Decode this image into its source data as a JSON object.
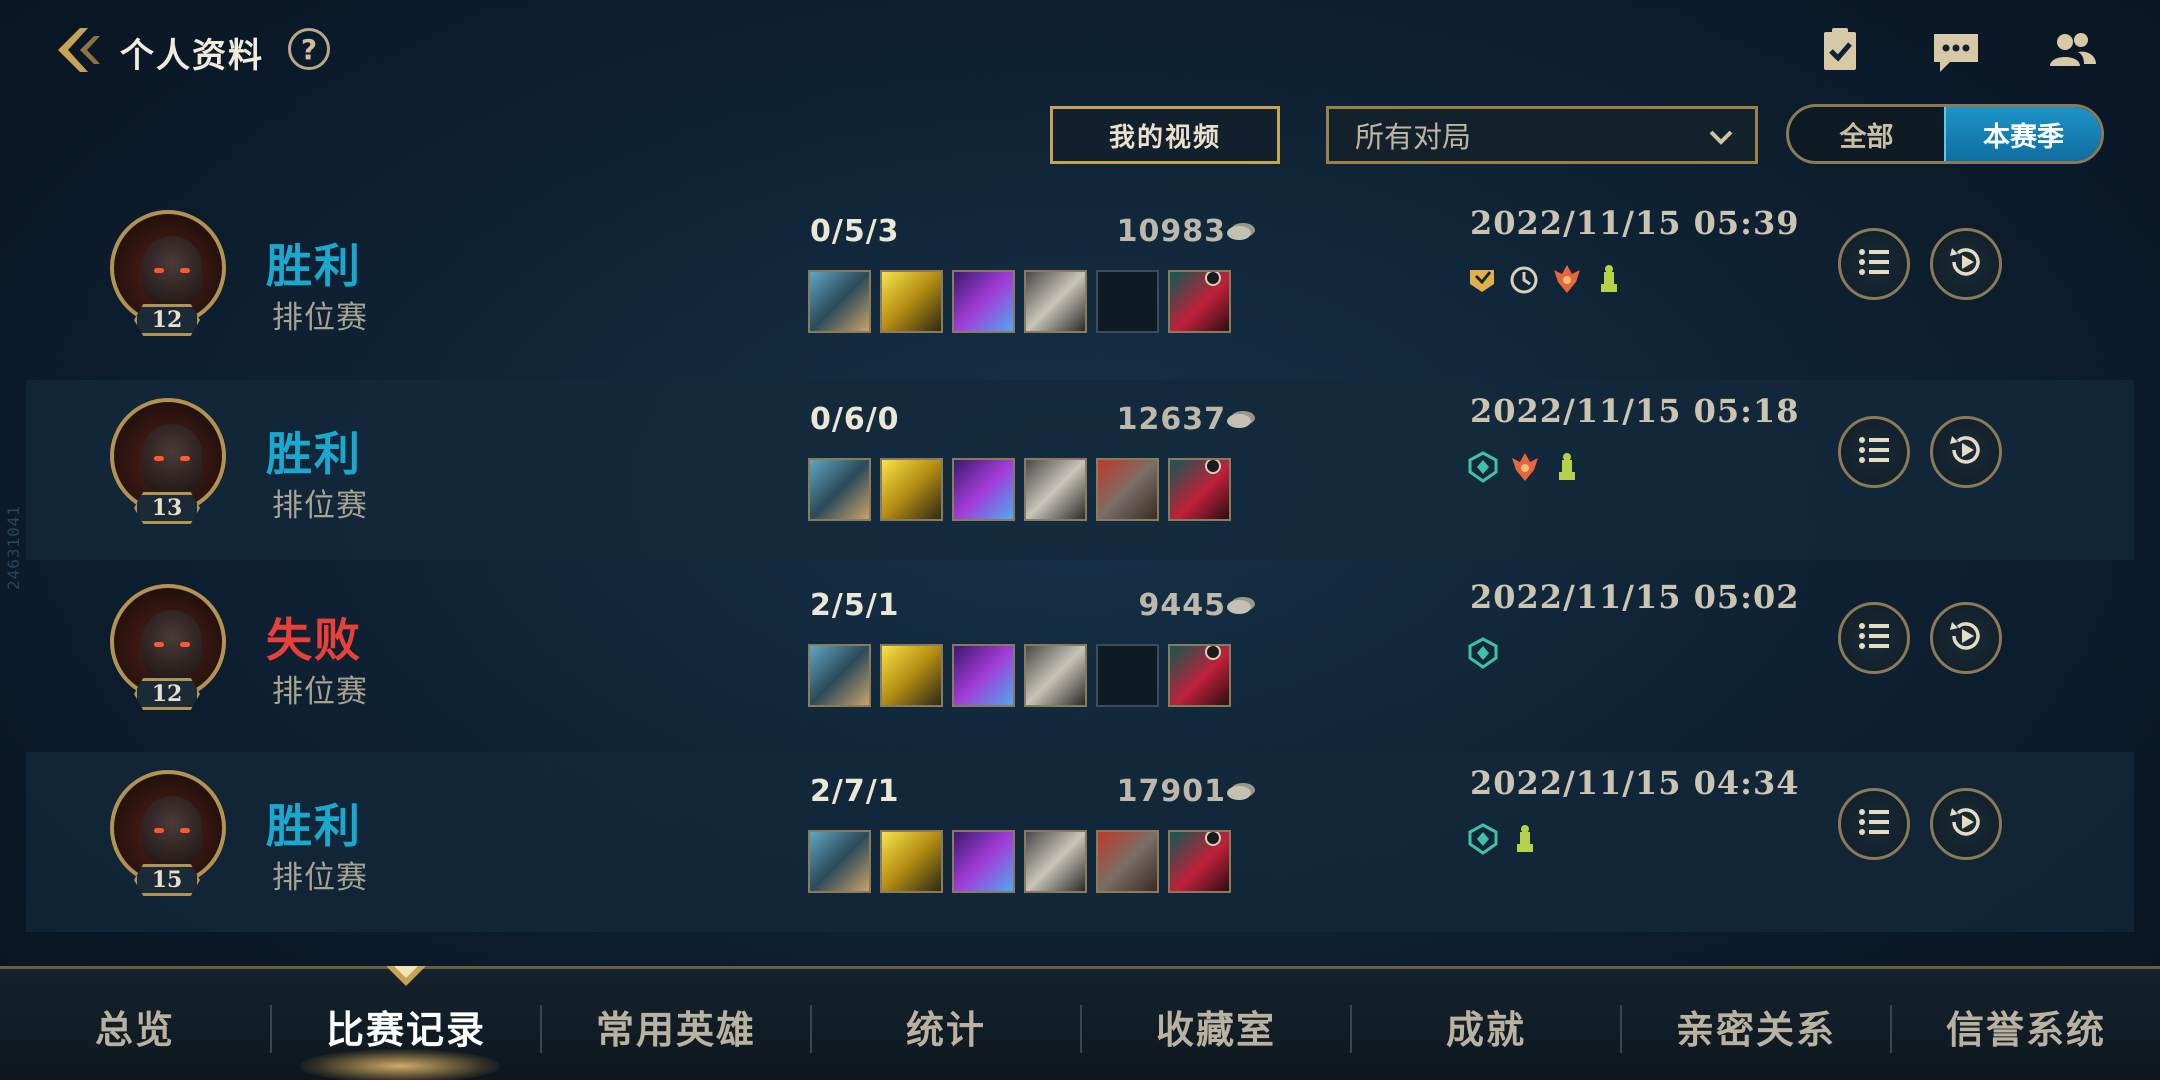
{
  "header": {
    "title": "个人资料",
    "help_label": "?"
  },
  "watermark": "24631041",
  "controls": {
    "my_videos_label": "我的视频",
    "match_filter": {
      "selected": "所有对局"
    },
    "season_toggle": {
      "options": [
        "全部",
        "本赛季"
      ],
      "active": "本赛季"
    }
  },
  "matches": [
    {
      "level": "12",
      "result": "胜利",
      "result_type": "win",
      "mode": "排位赛",
      "kda": "0/5/3",
      "gold": "10983",
      "date": "2022/11/15 05:39",
      "items": [
        "item-1-icon",
        "item-2-icon",
        "item-3-icon",
        "item-4-icon",
        "empty",
        "boots-icon"
      ],
      "tags": [
        "mvp-badge-icon",
        "timer-badge-icon",
        "flame-badge-icon",
        "tower-badge-icon"
      ]
    },
    {
      "level": "13",
      "result": "胜利",
      "result_type": "win",
      "mode": "排位赛",
      "kda": "0/6/0",
      "gold": "12637",
      "date": "2022/11/15 05:18",
      "items": [
        "item-1-icon",
        "item-2-icon",
        "item-3-icon",
        "item-4-icon",
        "item-5-icon",
        "boots-icon"
      ],
      "tags": [
        "shield-badge-icon",
        "flame-badge-icon",
        "tower-badge-icon"
      ]
    },
    {
      "level": "12",
      "result": "失败",
      "result_type": "lose",
      "mode": "排位赛",
      "kda": "2/5/1",
      "gold": "9445",
      "date": "2022/11/15 05:02",
      "items": [
        "item-1-icon",
        "item-2-icon",
        "item-3-icon",
        "item-4-icon",
        "empty",
        "boots-icon"
      ],
      "tags": [
        "shield-badge-icon"
      ]
    },
    {
      "level": "15",
      "result": "胜利",
      "result_type": "win",
      "mode": "排位赛",
      "kda": "2/7/1",
      "gold": "17901",
      "date": "2022/11/15 04:34",
      "items": [
        "item-1-icon",
        "item-2-icon",
        "item-3-icon",
        "item-4-icon",
        "item-5-icon",
        "boots-icon"
      ],
      "tags": [
        "shield-badge-icon",
        "tower-badge-icon"
      ]
    }
  ],
  "bottom_nav": {
    "items": [
      "总览",
      "比赛记录",
      "常用英雄",
      "统计",
      "收藏室",
      "成就",
      "亲密关系",
      "信誉系统"
    ],
    "active": "比赛记录"
  },
  "colors": {
    "win": "#1aa8cf",
    "lose": "#e8413b",
    "gold_border": "#c6a456",
    "active_toggle": "#1e93c8"
  }
}
